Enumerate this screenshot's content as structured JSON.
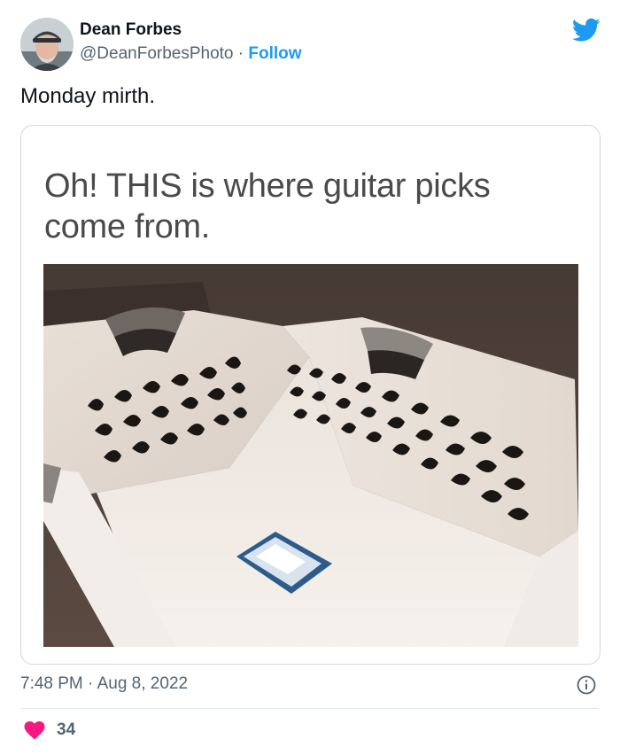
{
  "author": {
    "name": "Dean Forbes",
    "handle": "@DeanForbesPhoto",
    "separator": "·",
    "follow_label": "Follow"
  },
  "tweet": {
    "text": "Monday mirth.",
    "timestamp": "7:48 PM · Aug 8, 2022",
    "like_count": "34"
  },
  "media": {
    "caption_line1": "Oh!  THIS is where guitar picks",
    "caption_line2": "come from."
  },
  "colors": {
    "accent": "#1d9bf0",
    "like": "#f91880",
    "secondary_text": "#536471"
  },
  "icons": [
    "twitter-bird-icon",
    "info-icon",
    "heart-icon"
  ]
}
